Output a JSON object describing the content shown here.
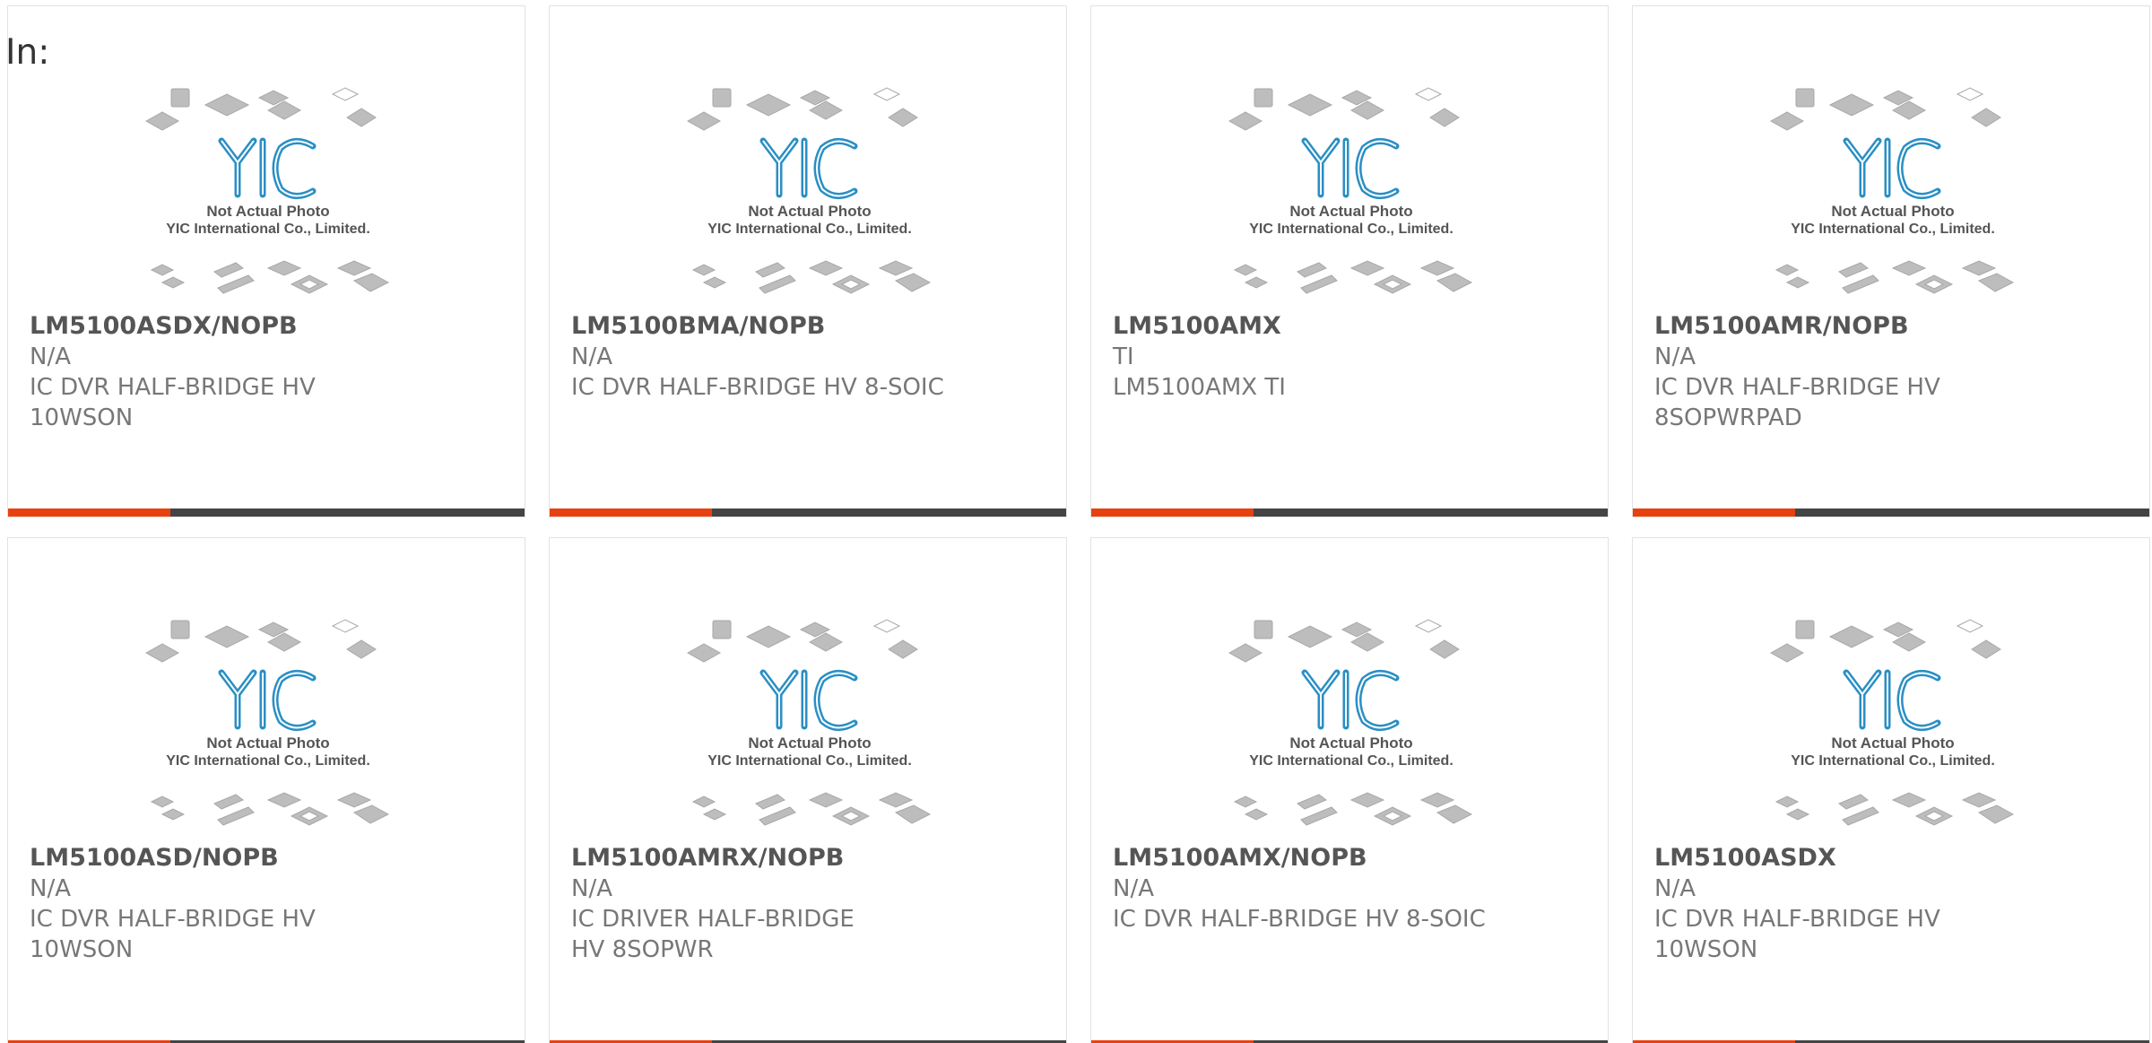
{
  "header": {
    "label": "In:"
  },
  "placeholder": {
    "line1": "Not Actual Photo",
    "line2": "YIC International Co., Limited.",
    "logo_text": "YIC",
    "logo_color": "#2a8fc4"
  },
  "colors": {
    "accent": "#e8410f",
    "bar": "#444444",
    "title": "#555555",
    "text": "#777777"
  },
  "products": [
    {
      "part": "LM5100ASDX/NOPB",
      "manufacturer": "N/A",
      "description": "IC DVR HALF-BRIDGE HV 10WSON"
    },
    {
      "part": "LM5100BMA/NOPB",
      "manufacturer": "N/A",
      "description": "IC DVR HALF-BRIDGE HV 8-SOIC"
    },
    {
      "part": "LM5100AMX",
      "manufacturer": "TI",
      "description": "LM5100AMX TI"
    },
    {
      "part": "LM5100AMR/NOPB",
      "manufacturer": "N/A",
      "description": "IC DVR HALF-BRIDGE HV 8SOPWRPAD"
    },
    {
      "part": "LM5100ASD/NOPB",
      "manufacturer": "N/A",
      "description": "IC DVR HALF-BRIDGE HV 10WSON"
    },
    {
      "part": "LM5100AMRX/NOPB",
      "manufacturer": "N/A",
      "description": "IC DRIVER HALF-BRIDGE HV 8SOPWR"
    },
    {
      "part": "LM5100AMX/NOPB",
      "manufacturer": "N/A",
      "description": "IC DVR HALF-BRIDGE HV 8-SOIC"
    },
    {
      "part": "LM5100ASDX",
      "manufacturer": "N/A",
      "description": "IC DVR HALF-BRIDGE HV 10WSON"
    }
  ]
}
